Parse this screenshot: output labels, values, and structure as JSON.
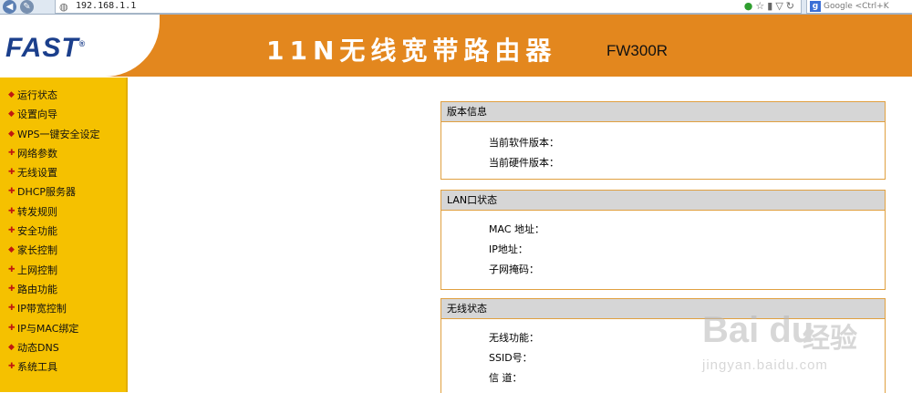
{
  "browser": {
    "url": "192.168.1.1",
    "search_hint": "Google <Ctrl+K"
  },
  "banner": {
    "logo": "FAST",
    "title": "11N无线宽带路由器",
    "model": "FW300R"
  },
  "sidebar": {
    "items": [
      {
        "label": "运行状态"
      },
      {
        "label": "设置向导"
      },
      {
        "label": "WPS一键安全设定"
      },
      {
        "label": "网络参数"
      },
      {
        "label": "无线设置"
      },
      {
        "label": "DHCP服务器"
      },
      {
        "label": "转发规则"
      },
      {
        "label": "安全功能"
      },
      {
        "label": "家长控制"
      },
      {
        "label": "上网控制"
      },
      {
        "label": "路由功能"
      },
      {
        "label": "IP带宽控制"
      },
      {
        "label": "IP与MAC绑定"
      },
      {
        "label": "动态DNS"
      },
      {
        "label": "系统工具"
      }
    ]
  },
  "panels": {
    "version": {
      "title": "版本信息",
      "software_label": "当前软件版本：",
      "hardware_label": "当前硬件版本："
    },
    "lan": {
      "title": "LAN口状态",
      "mac_label": "MAC 地址：",
      "ip_label": "IP地址：",
      "mask_label": "子网掩码："
    },
    "wireless": {
      "title": "无线状态",
      "func_label": "无线功能：",
      "ssid_label": "SSID号：",
      "channel_label": "信 道："
    }
  },
  "watermark": {
    "brand": "Bai du",
    "brand_cn": "经验",
    "url": "jingyan.baidu.com"
  },
  "colors": {
    "banner": "#e3871e",
    "sidebar": "#f5c100",
    "panel_border": "#e0a040",
    "panel_head": "#d6d6d6",
    "logo": "#1b3f8c"
  }
}
